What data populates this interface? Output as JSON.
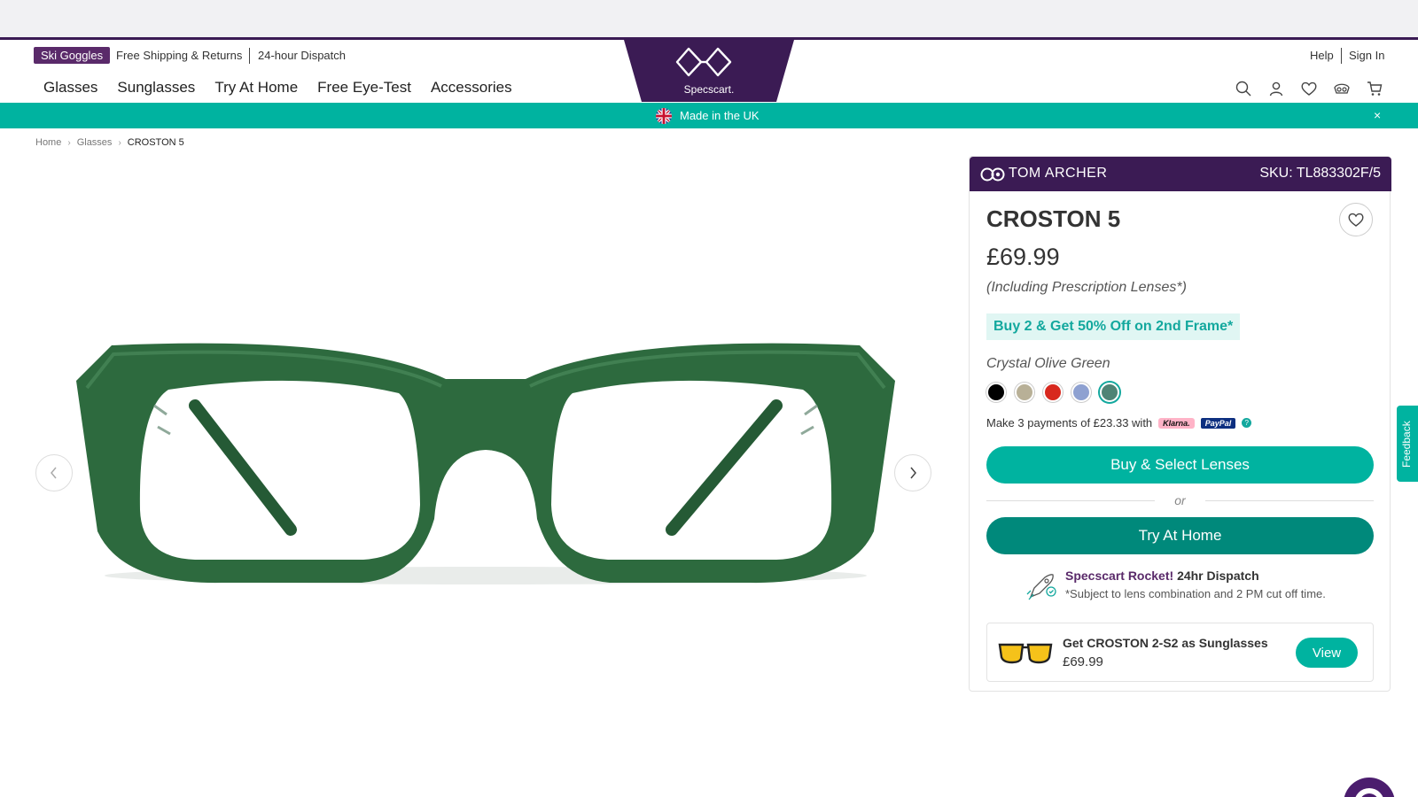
{
  "promo_bar": {
    "tag": "Ski Goggles",
    "shipping": "Free Shipping & Returns",
    "dispatch": "24-hour Dispatch"
  },
  "nav": {
    "items": [
      "Glasses",
      "Sunglasses",
      "Try At Home",
      "Free Eye-Test",
      "Accessories"
    ]
  },
  "logo": {
    "text": "Specscart."
  },
  "utility": {
    "help": "Help",
    "signin": "Sign In",
    "icons": [
      "search-icon",
      "user-icon",
      "heart-icon",
      "eye-test-icon",
      "cart-icon"
    ]
  },
  "banner": {
    "text": "Made in the UK",
    "close": "×"
  },
  "breadcrumb": {
    "home": "Home",
    "glasses": "Glasses",
    "current": "CROSTON 5"
  },
  "product": {
    "brand": "TOM ARCHER",
    "sku": "SKU: TL883302F/5",
    "name": "CROSTON 5",
    "price": "£69.99",
    "price_note": "(Including Prescription Lenses*)",
    "offer": "Buy 2 & Get 50% Off on 2nd Frame*",
    "color_name": "Crystal Olive Green",
    "swatches": [
      "#000000",
      "#b8b097",
      "#d8281e",
      "#8ea1d1",
      "#4f8476"
    ],
    "selected_swatch": 4,
    "paylater_text": "Make 3 payments of £23.33 with",
    "klarna": "Klarna.",
    "paypal": "PayPal",
    "help": "?",
    "buy_button": "Buy & Select Lenses",
    "or": "or",
    "try_button": "Try At Home",
    "rocket_brand": "Specscart Rocket!",
    "rocket_sub": "24hr Dispatch",
    "rocket_note": "*Subject to lens combination and 2 PM cut off time.",
    "sunglasses_title": "Get CROSTON 2-S2 as Sunglasses",
    "sunglasses_price": "£69.99",
    "sunglasses_button": "View"
  },
  "feedback": {
    "label": "Feedback"
  },
  "colors": {
    "brand_purple": "#3b1b54",
    "teal": "#00b3a0",
    "teal_dark": "#00897b",
    "frame_green": "#2d6a3e"
  }
}
